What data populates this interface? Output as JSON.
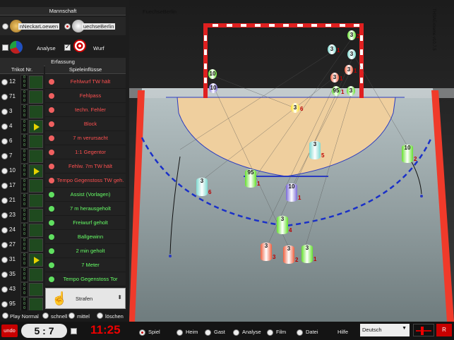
{
  "left": {
    "header_team": "Mannschaft",
    "teams": [
      {
        "label": "nNeckarLoewen",
        "selected": false
      },
      {
        "label": "uechseBerlin",
        "selected": true
      }
    ],
    "analyse": "Analyse",
    "wurf": "Wurf",
    "header_erfassung": "Erfassung",
    "col_trikot": "Trikot Nr.",
    "col_events": "Spieleinflüsse",
    "players": [
      "12",
      "71",
      "3",
      "4",
      "6",
      "7",
      "10",
      "17",
      "21",
      "23",
      "24",
      "27",
      "31",
      "35",
      "43",
      "95"
    ],
    "events_red": [
      "Fehlwurf TW hält",
      "Fehlpass",
      "techn. Fehler",
      "Block",
      "7 m verursacht",
      "1:1 Gegentor",
      "Fehlw. 7m TW hält",
      "Tempo Gegenstoss TW geh."
    ],
    "events_green": [
      "Assist (Vorlagen)",
      "7 m herausgeholt",
      "Freiwurf geholt",
      "Ballgewinn",
      "2 min geholt",
      "7 Meter",
      "Tempo Gegenstoss Tor"
    ],
    "strafen": "Strafen",
    "play": {
      "normal": "Play Normal",
      "schnell": "schnell",
      "mittel": "mittel",
      "loeschen": "löschen"
    }
  },
  "bottom": {
    "undo": "undo",
    "score": "5 : 7",
    "time": "11:25",
    "tabs": [
      "Spiel",
      "Heim",
      "Gast",
      "Analyse",
      "Film",
      "Datei"
    ],
    "hilfe": "Hilfe",
    "lang": "Deutsch",
    "r": "R"
  },
  "field": {
    "team": "FuechseBerlin",
    "version": "THSAExtreme v10.7.5"
  },
  "colors": {
    "red": "#ff5050",
    "green": "#66ff66",
    "accent": "#c80000",
    "court": "#efcf9e"
  }
}
